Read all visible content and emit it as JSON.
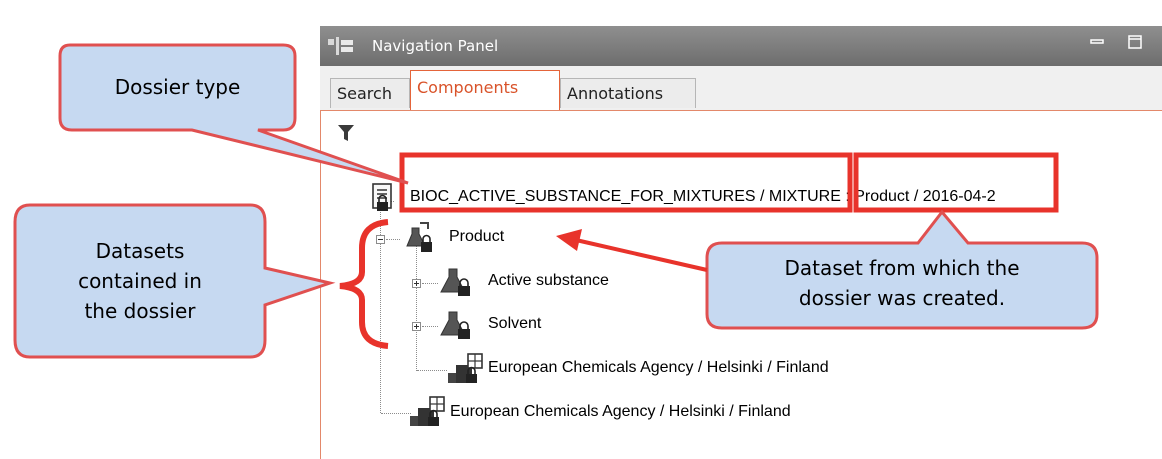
{
  "panel": {
    "title": "Navigation Panel",
    "tabs": [
      {
        "label": "Search"
      },
      {
        "label": "Components"
      },
      {
        "label": "Annotations"
      }
    ],
    "active_tab": "Components"
  },
  "tree": {
    "root": {
      "label": "BIOC_ACTIVE_SUBSTANCE_FOR_MIXTURES / MIXTURE : Product / 2016-04-2",
      "parts": {
        "dossier_type": "BIOC_ACTIVE_SUBSTANCE_FOR_MIXTURES",
        "separator": " / ",
        "dataset": "MIXTURE : Product",
        "rest": " / 2016-04-2"
      }
    },
    "product": {
      "label": "Product"
    },
    "active_substance": {
      "label": "Active substance"
    },
    "solvent": {
      "label": "Solvent"
    },
    "legal_entity_inner": {
      "label": "European Chemicals Agency / Helsinki / Finland"
    },
    "legal_entity_outer": {
      "label": "European Chemicals Agency / Helsinki / Finland"
    }
  },
  "callouts": {
    "dossier_type": "Dossier type",
    "datasets_line1": "Datasets",
    "datasets_line2": "contained in",
    "datasets_line3": "the dossier",
    "dataset_source_line1": "Dataset from which the",
    "dataset_source_line2": "dossier was created."
  },
  "colors": {
    "callout_fill": "#c6d9f1",
    "callout_border": "#e05050",
    "highlight": "#e8332b",
    "tab_active": "#d9532a"
  }
}
